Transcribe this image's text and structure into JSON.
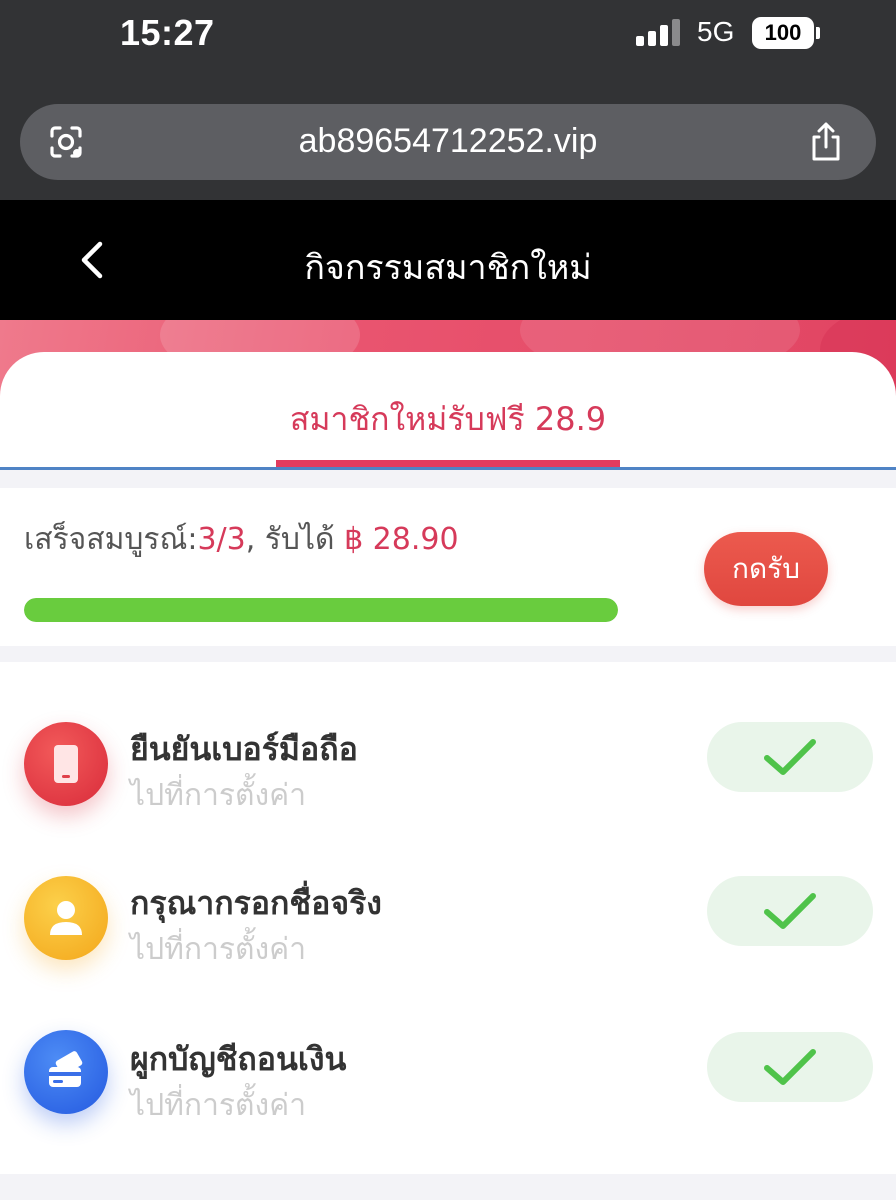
{
  "status_bar": {
    "time": "15:27",
    "network": "5G",
    "battery": "100"
  },
  "browser": {
    "url": "ab89654712252.vip",
    "left_icon": "visual-lookup-icon",
    "right_icon": "share-icon"
  },
  "header": {
    "title": "กิจกรรมสมาชิกใหม่",
    "back_icon": "chevron-left-icon"
  },
  "tab": {
    "label": "สมาชิกใหม่รับฟรี 28.9"
  },
  "progress": {
    "prefix": "เสร็จสมบูรณ์:",
    "count": "3/3",
    "middle": ", รับได้ ",
    "amount": "฿ 28.90",
    "claim_label": "กดรับ",
    "fraction": 1.0
  },
  "tasks": [
    {
      "title": "ยืนยันเบอร์มือถือ",
      "subtitle": "ไปที่การตั้งค่า",
      "icon": "phone-icon",
      "done": true
    },
    {
      "title": "กรุณากรอกชื่อจริง",
      "subtitle": "ไปที่การตั้งค่า",
      "icon": "user-icon",
      "done": true
    },
    {
      "title": "ผูกบัญชีถอนเงิน",
      "subtitle": "ไปที่การตั้งค่า",
      "icon": "card-icon",
      "done": true
    }
  ],
  "colors": {
    "accent": "#d63a5a",
    "progress": "#69cc3e",
    "claim": "#e0473f",
    "check": "#4fc34a"
  }
}
